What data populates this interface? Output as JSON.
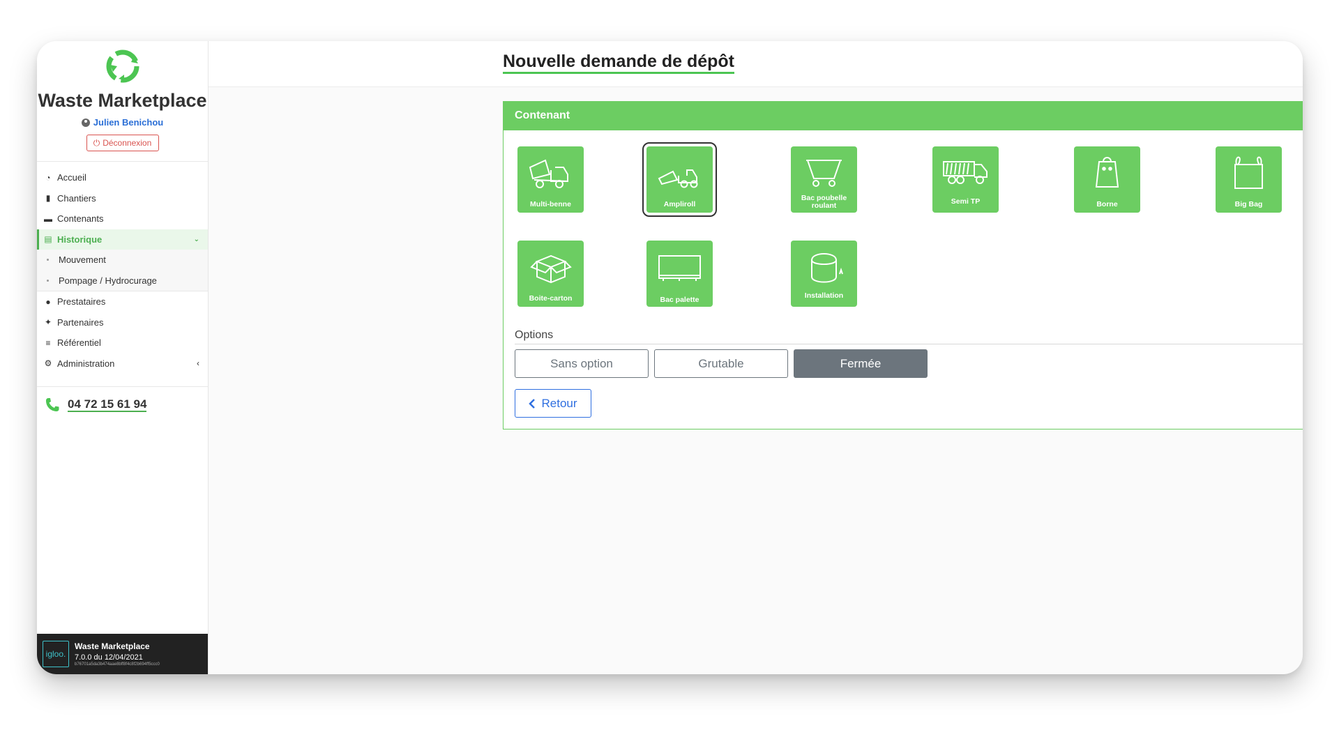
{
  "app": {
    "name": "Waste Marketplace"
  },
  "user": {
    "name": "Julien Benichou",
    "logout_label": "Déconnexion"
  },
  "nav": {
    "items": [
      {
        "label": "Accueil",
        "icon": "dashboard-icon"
      },
      {
        "label": "Chantiers",
        "icon": "building-icon"
      },
      {
        "label": "Contenants",
        "icon": "container-icon"
      },
      {
        "label": "Historique",
        "icon": "document-icon",
        "active": true
      },
      {
        "label": "Prestataires",
        "icon": "user-icon"
      },
      {
        "label": "Partenaires",
        "icon": "handshake-icon"
      },
      {
        "label": "Référentiel",
        "icon": "list-icon"
      },
      {
        "label": "Administration",
        "icon": "gears-icon"
      }
    ],
    "historique_sub": [
      {
        "label": "Mouvement"
      },
      {
        "label": "Pompage / Hydrocurage"
      }
    ]
  },
  "phone": "04 72 15 61 94",
  "footer": {
    "logo_text": "igloo.",
    "title": "Waste Marketplace",
    "version": "7.0.0 du 12/04/2021",
    "hash": "b76701a5da3b474aae8bff8f4c8f2b694ff5ccc0"
  },
  "page": {
    "title": "Nouvelle demande de dépôt"
  },
  "panel": {
    "header": "Contenant",
    "tiles": [
      {
        "label": "Multi-benne",
        "icon": "multi-benne-truck-icon"
      },
      {
        "label": "Ampliroll",
        "icon": "ampliroll-truck-icon",
        "selected": true
      },
      {
        "label": "Bac poubelle roulant",
        "icon": "rolling-bin-icon"
      },
      {
        "label": "Semi TP",
        "icon": "semi-trailer-icon"
      },
      {
        "label": "Borne",
        "icon": "bag-terminal-icon"
      },
      {
        "label": "Big Bag",
        "icon": "big-bag-icon"
      },
      {
        "label": "Boite-carton",
        "icon": "cardboard-box-icon"
      },
      {
        "label": "Bac palette",
        "icon": "pallet-bin-icon"
      },
      {
        "label": "Installation",
        "icon": "tank-installation-icon"
      }
    ],
    "options_label": "Options",
    "options": [
      {
        "label": "Sans option",
        "active": false
      },
      {
        "label": "Grutable",
        "active": false
      },
      {
        "label": "Fermée",
        "active": true
      }
    ],
    "back_label": "Retour"
  },
  "colors": {
    "accent": "#6ccd62",
    "primary": "#2f6fe0",
    "danger": "#d9534f",
    "secondary": "#6c757d"
  }
}
